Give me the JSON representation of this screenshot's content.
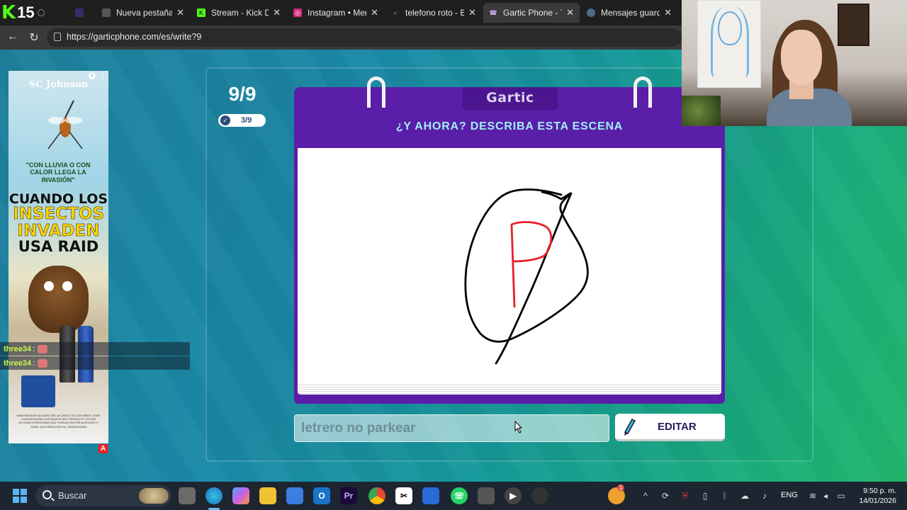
{
  "browser": {
    "kick_counter": "15",
    "tabs": [
      {
        "label": "Nueva pestaña",
        "icon": "new-tab-icon",
        "active": false
      },
      {
        "label": "Stream - Kick Dash",
        "icon": "kick-icon",
        "active": false
      },
      {
        "label": "Instagram • Mensa",
        "icon": "instagram-icon",
        "active": false
      },
      {
        "label": "telefono roto - Bús",
        "icon": "search-icon",
        "active": false
      },
      {
        "label": "Gartic Phone - Tele",
        "icon": "gartic-icon",
        "active": true
      },
      {
        "label": "Mensajes guardad",
        "icon": "telegram-icon",
        "active": false
      }
    ],
    "url": "https://garticphone.com/es/write?9"
  },
  "ad": {
    "brand": "SC Johnson",
    "quote": "\"CON LLUVIA O CON CALOR LLEGA LA INVASIÓN\"",
    "headline_1": "CUANDO LOS",
    "headline_2": "INSECTOS",
    "headline_3": "INVADEN",
    "headline_4": "USA RAID",
    "fine_print": "MANTÉNGASE ALEJADO DEL ALCANCE DE LOS NIÑOS. LEER CON ATENCIÓN LA ETIQUETA DEL PRODUCTO. EVITAR APLICAR A PERSONAS QUE PUEDAN SUFRIR ALERGIAS O ASMA. AUTORIZACIÓN No. 253300011085",
    "ad_badge": "A"
  },
  "chat": [
    {
      "user": "three34",
      "sep": ":"
    },
    {
      "user": "three34",
      "sep": ":"
    }
  ],
  "game": {
    "round": "9/9",
    "done_count": "3/9",
    "logo": "Gartic",
    "prompt": "¿Y AHORA? DESCRIBA ESTA ESCENA",
    "answer_text": "letrero no parkear",
    "edit_label": "EDITAR",
    "drawing": {
      "stroke_colors": [
        "#000000",
        "#e8202a"
      ],
      "letter": "P"
    }
  },
  "taskbar": {
    "search_label": "Buscar",
    "apps": [
      "file-explorer-icon",
      "edge-icon",
      "copilot-icon",
      "folder-icon",
      "store-icon",
      "outlook-icon",
      "premiere-icon",
      "chrome-icon",
      "capcut-icon",
      "snipping-icon",
      "whatsapp-icon",
      "notepad-icon",
      "media-player-icon",
      "obs-icon"
    ],
    "language": "ENG",
    "time": "9:50 p. m.",
    "date": "14/01/2026",
    "notification_badge": "1"
  }
}
